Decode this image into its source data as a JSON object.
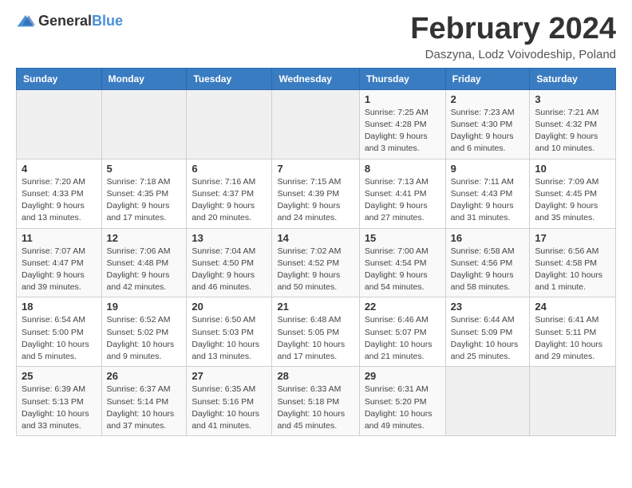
{
  "header": {
    "logo_general": "General",
    "logo_blue": "Blue",
    "title": "February 2024",
    "subtitle": "Daszyna, Lodz Voivodeship, Poland"
  },
  "weekdays": [
    "Sunday",
    "Monday",
    "Tuesday",
    "Wednesday",
    "Thursday",
    "Friday",
    "Saturday"
  ],
  "weeks": [
    [
      {
        "day": "",
        "info": ""
      },
      {
        "day": "",
        "info": ""
      },
      {
        "day": "",
        "info": ""
      },
      {
        "day": "",
        "info": ""
      },
      {
        "day": "1",
        "info": "Sunrise: 7:25 AM\nSunset: 4:28 PM\nDaylight: 9 hours\nand 3 minutes."
      },
      {
        "day": "2",
        "info": "Sunrise: 7:23 AM\nSunset: 4:30 PM\nDaylight: 9 hours\nand 6 minutes."
      },
      {
        "day": "3",
        "info": "Sunrise: 7:21 AM\nSunset: 4:32 PM\nDaylight: 9 hours\nand 10 minutes."
      }
    ],
    [
      {
        "day": "4",
        "info": "Sunrise: 7:20 AM\nSunset: 4:33 PM\nDaylight: 9 hours\nand 13 minutes."
      },
      {
        "day": "5",
        "info": "Sunrise: 7:18 AM\nSunset: 4:35 PM\nDaylight: 9 hours\nand 17 minutes."
      },
      {
        "day": "6",
        "info": "Sunrise: 7:16 AM\nSunset: 4:37 PM\nDaylight: 9 hours\nand 20 minutes."
      },
      {
        "day": "7",
        "info": "Sunrise: 7:15 AM\nSunset: 4:39 PM\nDaylight: 9 hours\nand 24 minutes."
      },
      {
        "day": "8",
        "info": "Sunrise: 7:13 AM\nSunset: 4:41 PM\nDaylight: 9 hours\nand 27 minutes."
      },
      {
        "day": "9",
        "info": "Sunrise: 7:11 AM\nSunset: 4:43 PM\nDaylight: 9 hours\nand 31 minutes."
      },
      {
        "day": "10",
        "info": "Sunrise: 7:09 AM\nSunset: 4:45 PM\nDaylight: 9 hours\nand 35 minutes."
      }
    ],
    [
      {
        "day": "11",
        "info": "Sunrise: 7:07 AM\nSunset: 4:47 PM\nDaylight: 9 hours\nand 39 minutes."
      },
      {
        "day": "12",
        "info": "Sunrise: 7:06 AM\nSunset: 4:48 PM\nDaylight: 9 hours\nand 42 minutes."
      },
      {
        "day": "13",
        "info": "Sunrise: 7:04 AM\nSunset: 4:50 PM\nDaylight: 9 hours\nand 46 minutes."
      },
      {
        "day": "14",
        "info": "Sunrise: 7:02 AM\nSunset: 4:52 PM\nDaylight: 9 hours\nand 50 minutes."
      },
      {
        "day": "15",
        "info": "Sunrise: 7:00 AM\nSunset: 4:54 PM\nDaylight: 9 hours\nand 54 minutes."
      },
      {
        "day": "16",
        "info": "Sunrise: 6:58 AM\nSunset: 4:56 PM\nDaylight: 9 hours\nand 58 minutes."
      },
      {
        "day": "17",
        "info": "Sunrise: 6:56 AM\nSunset: 4:58 PM\nDaylight: 10 hours\nand 1 minute."
      }
    ],
    [
      {
        "day": "18",
        "info": "Sunrise: 6:54 AM\nSunset: 5:00 PM\nDaylight: 10 hours\nand 5 minutes."
      },
      {
        "day": "19",
        "info": "Sunrise: 6:52 AM\nSunset: 5:02 PM\nDaylight: 10 hours\nand 9 minutes."
      },
      {
        "day": "20",
        "info": "Sunrise: 6:50 AM\nSunset: 5:03 PM\nDaylight: 10 hours\nand 13 minutes."
      },
      {
        "day": "21",
        "info": "Sunrise: 6:48 AM\nSunset: 5:05 PM\nDaylight: 10 hours\nand 17 minutes."
      },
      {
        "day": "22",
        "info": "Sunrise: 6:46 AM\nSunset: 5:07 PM\nDaylight: 10 hours\nand 21 minutes."
      },
      {
        "day": "23",
        "info": "Sunrise: 6:44 AM\nSunset: 5:09 PM\nDaylight: 10 hours\nand 25 minutes."
      },
      {
        "day": "24",
        "info": "Sunrise: 6:41 AM\nSunset: 5:11 PM\nDaylight: 10 hours\nand 29 minutes."
      }
    ],
    [
      {
        "day": "25",
        "info": "Sunrise: 6:39 AM\nSunset: 5:13 PM\nDaylight: 10 hours\nand 33 minutes."
      },
      {
        "day": "26",
        "info": "Sunrise: 6:37 AM\nSunset: 5:14 PM\nDaylight: 10 hours\nand 37 minutes."
      },
      {
        "day": "27",
        "info": "Sunrise: 6:35 AM\nSunset: 5:16 PM\nDaylight: 10 hours\nand 41 minutes."
      },
      {
        "day": "28",
        "info": "Sunrise: 6:33 AM\nSunset: 5:18 PM\nDaylight: 10 hours\nand 45 minutes."
      },
      {
        "day": "29",
        "info": "Sunrise: 6:31 AM\nSunset: 5:20 PM\nDaylight: 10 hours\nand 49 minutes."
      },
      {
        "day": "",
        "info": ""
      },
      {
        "day": "",
        "info": ""
      }
    ]
  ]
}
